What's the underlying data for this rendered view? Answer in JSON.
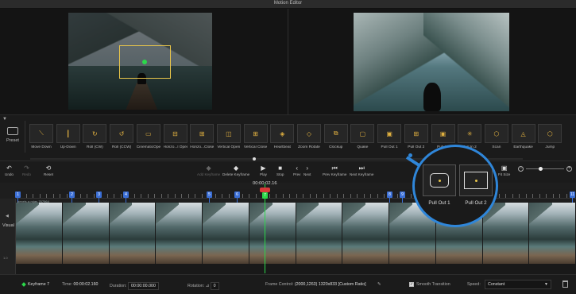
{
  "window": {
    "title": "Motion Editor"
  },
  "presets": {
    "preset_label": "Preset",
    "tiles": [
      {
        "label": "Move Down",
        "glyph": "⟍"
      },
      {
        "label": "Up-Down",
        "glyph": "┃"
      },
      {
        "label": "Roll (CW)",
        "glyph": "↻"
      },
      {
        "label": "Roll (CCW)",
        "glyph": "↺"
      },
      {
        "label": "CinematicOpen",
        "glyph": "▭"
      },
      {
        "label": "Horizo...l Open",
        "glyph": "⊟"
      },
      {
        "label": "Horizo...Close",
        "glyph": "⊞"
      },
      {
        "label": "Vertical Open",
        "glyph": "◫"
      },
      {
        "label": "Vertical Close",
        "glyph": "⊞"
      },
      {
        "label": "Heartbeat",
        "glyph": "◈"
      },
      {
        "label": "Zoom Rotate",
        "glyph": "◇"
      },
      {
        "label": "Clockup",
        "glyph": "⧉"
      },
      {
        "label": "Quake",
        "glyph": "▢"
      },
      {
        "label": "Pull Out 1",
        "glyph": "▣"
      },
      {
        "label": "Pull Out 2",
        "glyph": "⊞"
      },
      {
        "label": "Pull I...",
        "glyph": "▣"
      },
      {
        "label": "Pull In 2",
        "glyph": "✳"
      },
      {
        "label": "Scan",
        "glyph": "⬡"
      },
      {
        "label": "Earthquake",
        "glyph": "◬"
      },
      {
        "label": "Jump",
        "glyph": "⬡"
      }
    ]
  },
  "toolbar": {
    "undo": "Undo",
    "redo": "Redo",
    "reset": "Reset",
    "add_keyframe": "Add Keyframe",
    "delete_keyframe": "Delete Keyframe",
    "play": "Play",
    "stop": "Stop",
    "prev": "Prev",
    "next": "Next",
    "prev_keyframe": "Prev Keyframe",
    "next_keyframe": "Next Keyframe",
    "fit_size": "Fit Size"
  },
  "timeline": {
    "timecode": "00:00:02.16",
    "track_label": "Visual",
    "track_sub": "1.0",
    "clip_title": "pexels-a-rojas-767964",
    "keyframe_numbers": [
      "1",
      "2",
      "3",
      "4",
      "5",
      "6",
      "8",
      "9",
      "10",
      "11"
    ],
    "current_keyframe": "7"
  },
  "bottom": {
    "keyframe_label": "Keyframe 7",
    "time_label": "Time:",
    "time_value": "00:00:02.160",
    "duration_label": "Duration:",
    "duration_value": "00:00:00.000",
    "rotation_label": "Rotation:",
    "rotation_value": "0",
    "frame_control_label": "Frame Control:",
    "frame_control_value": "(2000,1263)  1320x833  [Custom Ratio]",
    "smooth_label": "Smooth Transition",
    "speed_label": "Speed:",
    "speed_value": "Constant"
  },
  "magnifier": {
    "tile1": "Pull Out 1",
    "tile2": "Pull Out 2"
  },
  "colors": {
    "accent": "#2f86d9",
    "keyframe": "#3b6fd6",
    "playhead": "#2bd84a",
    "crop": "#e8c54a"
  }
}
